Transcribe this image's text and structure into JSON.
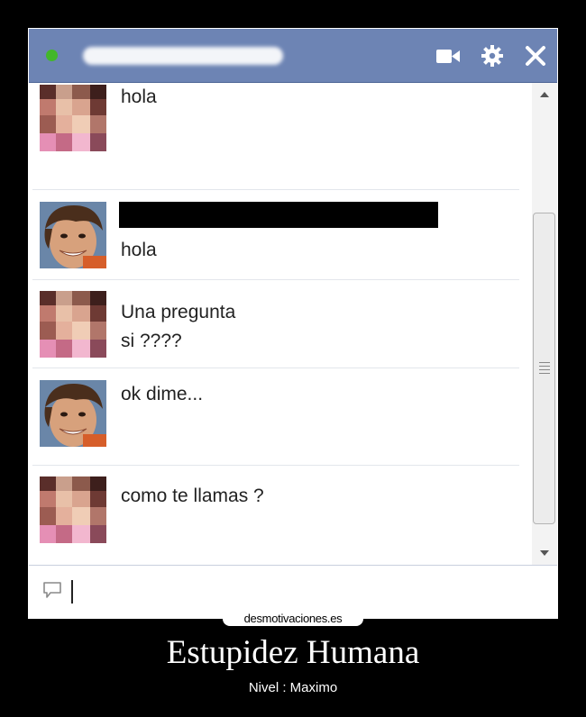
{
  "chat": {
    "contact_name": "",
    "messages": [
      {
        "sender": "pixelated-user",
        "text": "hola"
      },
      {
        "sender": "boy-user",
        "text": "hola",
        "redacted": true
      },
      {
        "sender": "pixelated-user",
        "text": "Una pregunta\nsi ????"
      },
      {
        "sender": "boy-user",
        "text": "ok dime..."
      },
      {
        "sender": "pixelated-user",
        "text": "como te llamas ?"
      }
    ],
    "input_value": ""
  },
  "icons": {
    "status": "online-status-dot",
    "video": "video-camera-icon",
    "settings": "gear-icon",
    "close": "close-icon",
    "composer": "speech-bubble-icon"
  },
  "colors": {
    "header": "#6d84b4",
    "status_online": "#42b72a"
  },
  "poster": {
    "watermark": "desmotivaciones.es",
    "title": "Estupidez Humana",
    "subtitle": "Nivel : Maximo"
  }
}
